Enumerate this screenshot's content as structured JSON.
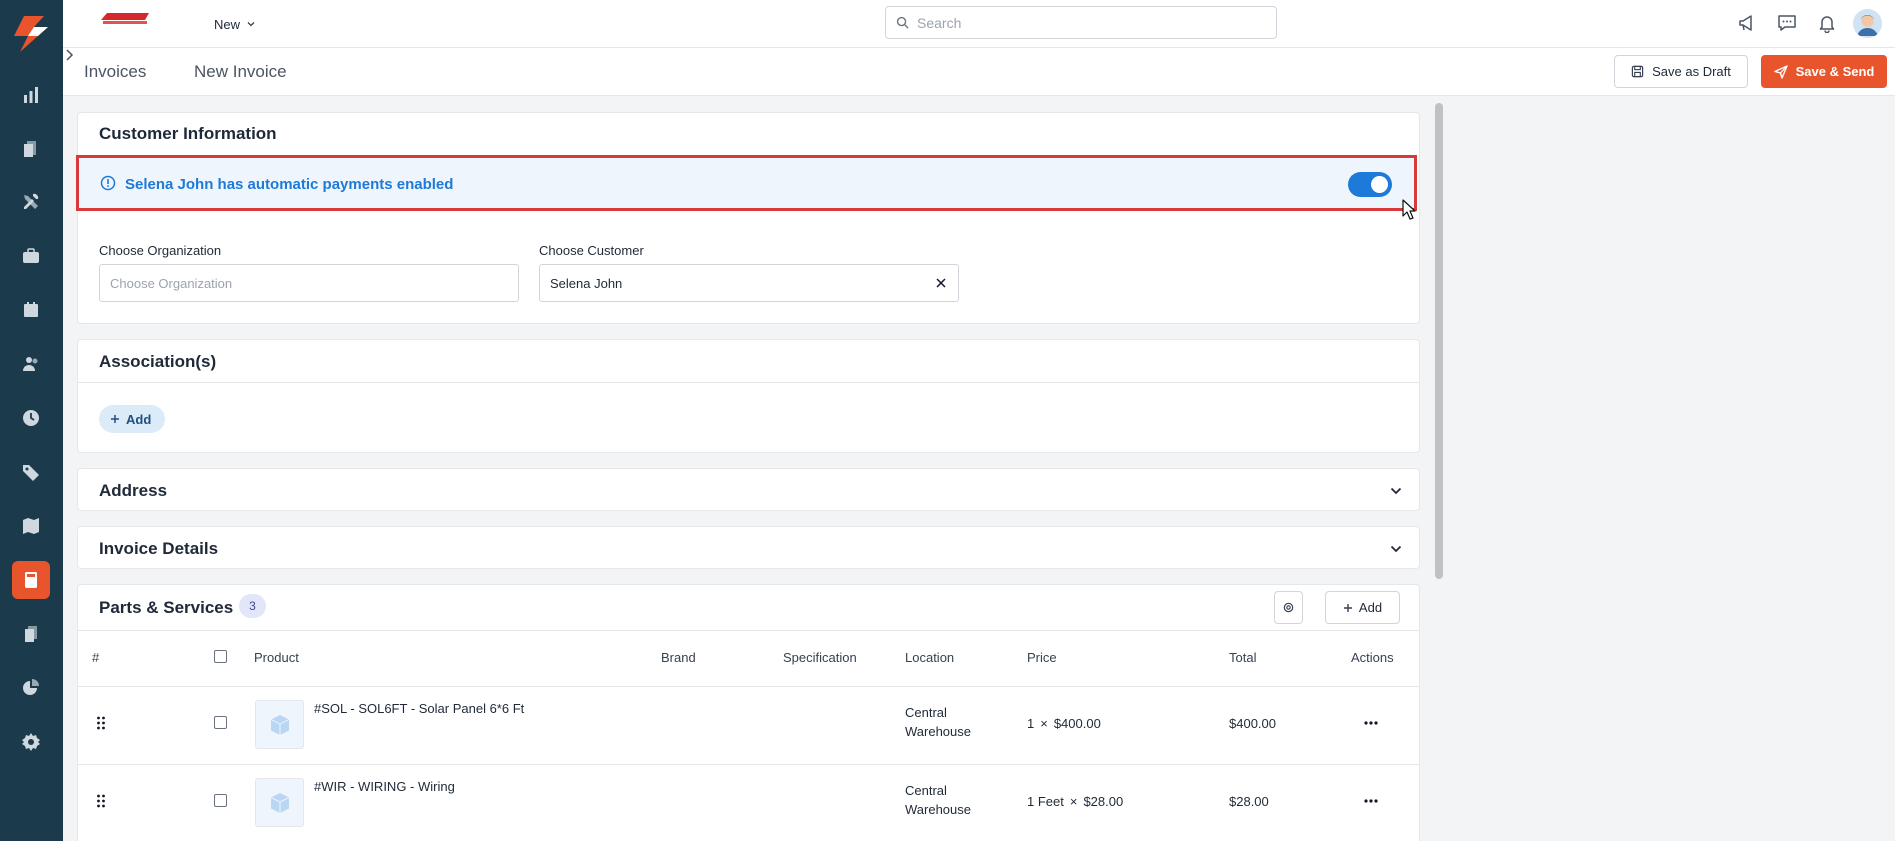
{
  "topbar": {
    "new_menu_label": "New",
    "search_placeholder": "Search"
  },
  "breadcrumb": {
    "parent": "Invoices",
    "current": "New Invoice"
  },
  "actions": {
    "save_draft": "Save as Draft",
    "save_send": "Save & Send"
  },
  "customer_info": {
    "title": "Customer Information",
    "alert_text": "Selena John has automatic payments enabled",
    "auto_payments_enabled": true,
    "organization_label": "Choose Organization",
    "organization_placeholder": "Choose Organization",
    "organization_value": "",
    "customer_label": "Choose Customer",
    "customer_value": "Selena John"
  },
  "associations": {
    "title": "Association(s)",
    "add_label": "Add"
  },
  "address": {
    "title": "Address"
  },
  "invoice_details": {
    "title": "Invoice Details"
  },
  "parts": {
    "title": "Parts & Services",
    "count": "3",
    "add_label": "Add",
    "columns": {
      "index": "#",
      "product": "Product",
      "brand": "Brand",
      "specification": "Specification",
      "location": "Location",
      "price": "Price",
      "total": "Total",
      "actions": "Actions"
    },
    "rows": [
      {
        "product": "#SOL - SOL6FT - Solar Panel 6*6 Ft",
        "location_line1": "Central",
        "location_line2": "Warehouse",
        "qty": "1",
        "times": "×",
        "unit_price": "$400.00",
        "total": "$400.00"
      },
      {
        "product": "#WIR - WIRING - Wiring",
        "location_line1": "Central",
        "location_line2": "Warehouse",
        "qty": "1 Feet",
        "times": "×",
        "unit_price": "$28.00",
        "total": "$28.00"
      }
    ]
  },
  "colors": {
    "sidebar": "#1b3a4b",
    "accent": "#e8542b",
    "info_blue": "#1d7ad8",
    "highlight_border": "#d83a3a"
  },
  "sidebar_icons": [
    "reports-icon",
    "documents-icon",
    "tools-icon",
    "briefcase-icon",
    "calendar-icon",
    "users-icon",
    "clock-icon",
    "tag-icon",
    "map-icon",
    "calculator-icon",
    "files-icon",
    "pie-chart-icon",
    "settings-icon"
  ]
}
